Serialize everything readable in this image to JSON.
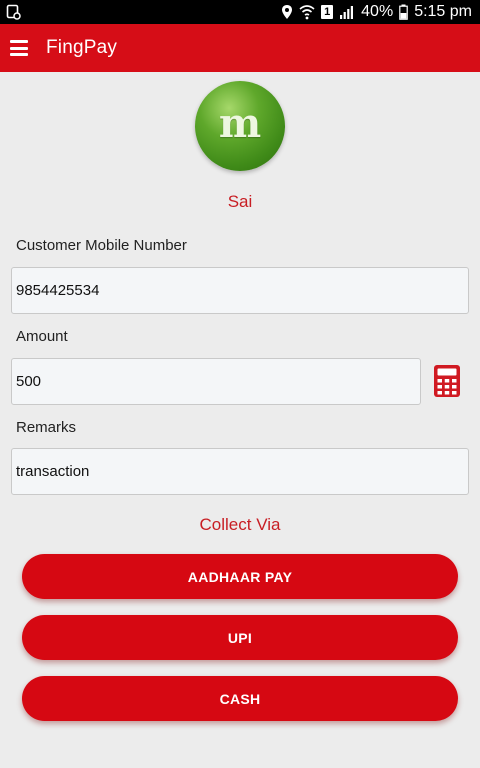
{
  "status_bar": {
    "battery": "40%",
    "time": "5:15 pm",
    "sim_slot": "1"
  },
  "app_bar": {
    "title": "FingPay"
  },
  "profile": {
    "avatar_letter": "m",
    "name": "Sai"
  },
  "form": {
    "mobile_label": "Customer Mobile Number",
    "mobile_value": "9854425534",
    "amount_label": "Amount",
    "amount_value": "500",
    "remarks_label": "Remarks",
    "remarks_value": "transaction"
  },
  "collect_via": {
    "label": "Collect Via",
    "buttons": {
      "aadhaar": "AADHAAR PAY",
      "upi": "UPI",
      "cash": "CASH"
    }
  },
  "colors": {
    "primary": "#d60d17",
    "accent_text": "#c81e24",
    "background": "#ececec"
  }
}
